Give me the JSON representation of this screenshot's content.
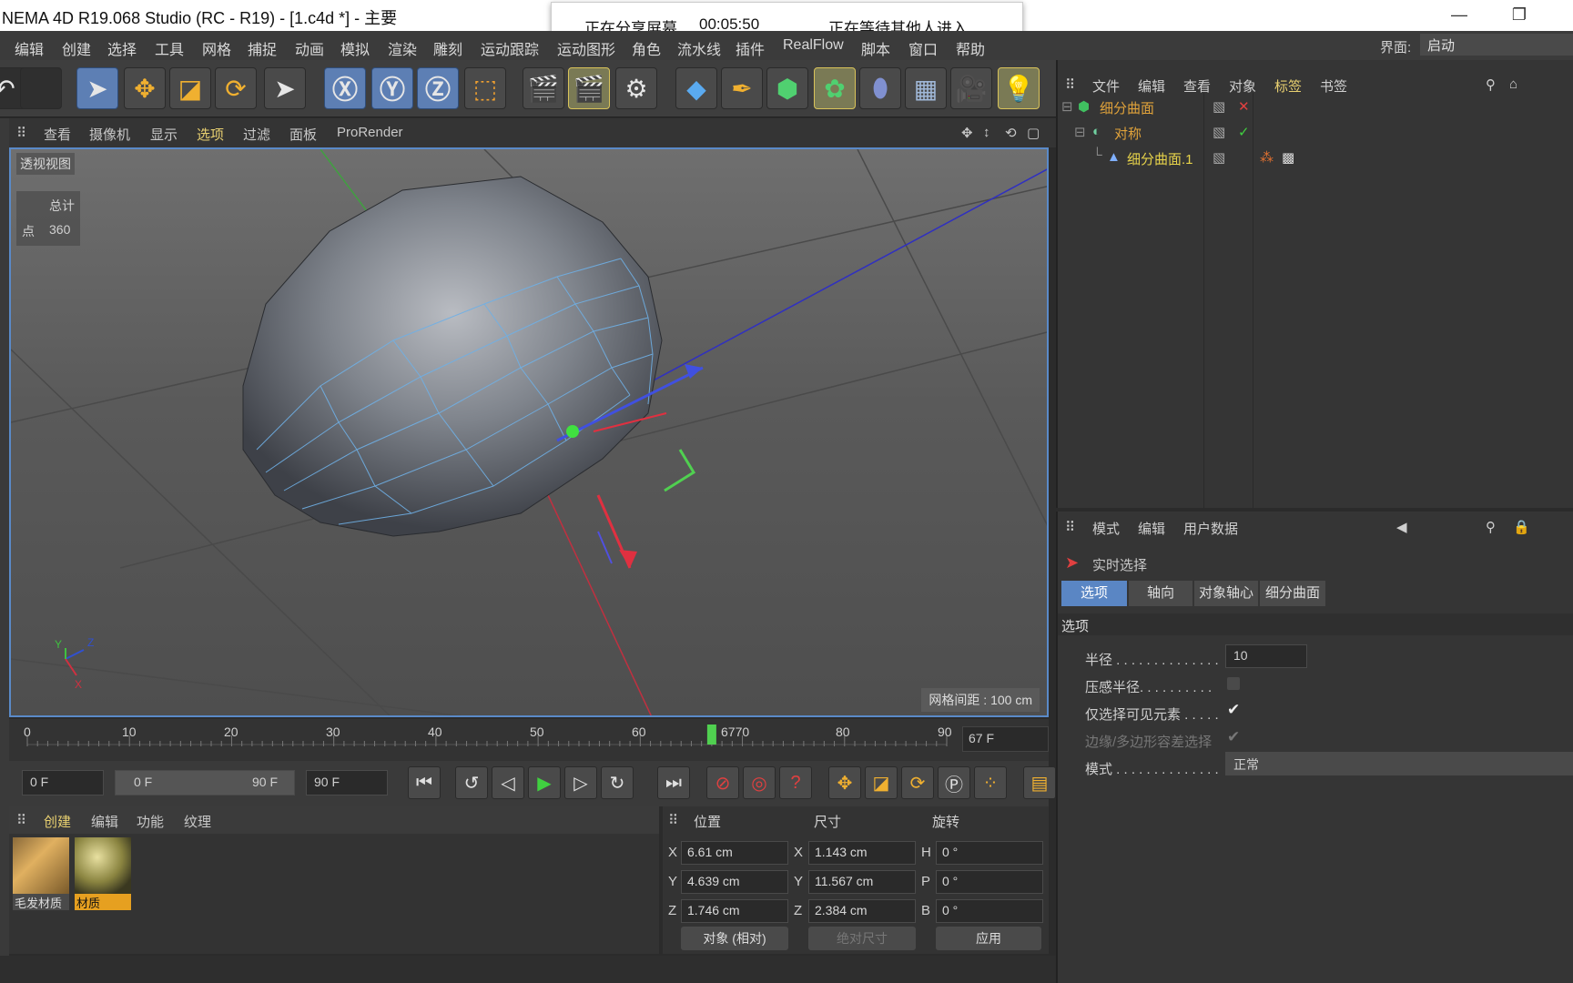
{
  "window": {
    "title": "NEMA 4D R19.068 Studio (RC - R19) - [1.c4d *] - 主要",
    "minimize": "—",
    "restore": "❐"
  },
  "share_banner": {
    "status": "正在分享屏幕",
    "timer": "00:05:50",
    "waiting": "正在等待其他人进入"
  },
  "menubar": {
    "items": [
      "编辑",
      "创建",
      "选择",
      "工具",
      "网格",
      "捕捉",
      "动画",
      "模拟",
      "渲染",
      "雕刻",
      "运动跟踪",
      "运动图形",
      "角色",
      "流水线",
      "插件",
      "RealFlow",
      "脚本",
      "窗口",
      "帮助"
    ],
    "layout_label": "界面:",
    "layout_value": "启动"
  },
  "viewport": {
    "menus": [
      "查看",
      "摄像机",
      "显示",
      "选项",
      "过滤",
      "面板",
      "ProRender"
    ],
    "label": "透视视图",
    "stats_header": "总计",
    "stats_row_label": "点",
    "stats_row_value": "360",
    "grid_spacing": "网格间距 : 100 cm",
    "axis_y": "Y",
    "axis_z": "Z",
    "axis_x": "X"
  },
  "timeline": {
    "ticks": [
      "0",
      "10",
      "20",
      "30",
      "40",
      "50",
      "60",
      "6770",
      "80",
      "90"
    ],
    "current_frame_value": 67,
    "current_frame": "67 F"
  },
  "transport": {
    "start": "0 F",
    "range_start": "0 F",
    "range_end": "90 F",
    "end": "90 F"
  },
  "material_panel": {
    "tabs": [
      "创建",
      "编辑",
      "功能",
      "纹理"
    ],
    "materials": [
      {
        "name": "毛发材质"
      },
      {
        "name": "材质"
      }
    ]
  },
  "coords": {
    "headers": {
      "position": "位置",
      "size": "尺寸",
      "rotation": "旋转"
    },
    "rows": [
      {
        "axis": "X",
        "pos": "6.61 cm",
        "size_axis": "X",
        "size": "1.143 cm",
        "rot_axis": "H",
        "rot": "0 °"
      },
      {
        "axis": "Y",
        "pos": "4.639 cm",
        "size_axis": "Y",
        "size": "11.567 cm",
        "rot_axis": "P",
        "rot": "0 °"
      },
      {
        "axis": "Z",
        "pos": "1.746 cm",
        "size_axis": "Z",
        "size": "2.384 cm",
        "rot_axis": "B",
        "rot": "0 °"
      }
    ],
    "mode": "对象 (相对)",
    "size_mode": "绝对尺寸",
    "apply": "应用"
  },
  "object_manager": {
    "menus": [
      "文件",
      "编辑",
      "查看",
      "对象",
      "标签",
      "书签"
    ],
    "objects": [
      {
        "name": "细分曲面",
        "color": "#e0a23a"
      },
      {
        "name": "对称",
        "color": "#e0a23a"
      },
      {
        "name": "细分曲面.1",
        "color": "#e6d24a"
      }
    ]
  },
  "attributes": {
    "menus": [
      "模式",
      "编辑",
      "用户数据"
    ],
    "tool_name": "实时选择",
    "tabs": [
      "选项",
      "轴向",
      "对象轴心",
      "细分曲面"
    ],
    "section": "选项",
    "fields": [
      {
        "label": "半径 . . . . . . . . . . . . . .",
        "value": "10"
      },
      {
        "label": "压感半径. . . . . . . . . .",
        "value": ""
      },
      {
        "label": "仅选择可见元素 . . . . .",
        "value": "✔"
      },
      {
        "label": "边缘/多边形容差选择",
        "value": "✔"
      },
      {
        "label": "模式 . . . . . . . . . . . . . .",
        "value": "正常"
      }
    ]
  },
  "colors": {
    "accent": "#5a86c4",
    "viewport_border": "#5a8ac8",
    "highlight": "#e6c84a"
  }
}
